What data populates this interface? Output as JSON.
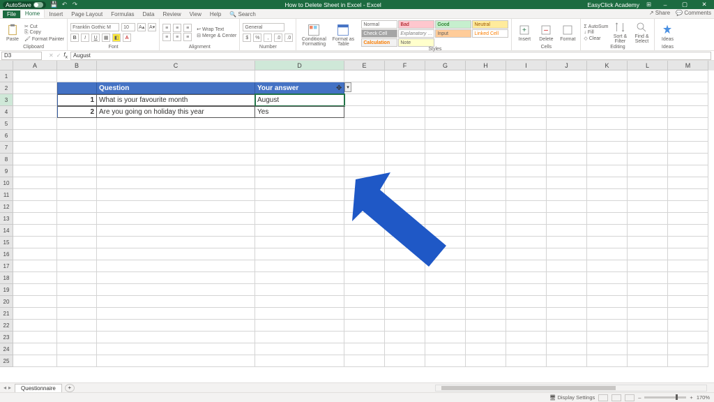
{
  "titlebar": {
    "autosave": "AutoSave",
    "doc_title": "How to Delete Sheet in Excel  -  Excel",
    "account": "EasyClick Academy",
    "min": "–",
    "max": "▢",
    "close": "✕"
  },
  "tabs": {
    "file": "File",
    "home": "Home",
    "insert": "Insert",
    "pagelayout": "Page Layout",
    "formulas": "Formulas",
    "data": "Data",
    "review": "Review",
    "view": "View",
    "help": "Help",
    "search": "Search",
    "share": "Share",
    "comments": "Comments"
  },
  "ribbon": {
    "clipboard": {
      "label": "Clipboard",
      "paste": "Paste",
      "cut": "Cut",
      "copy": "Copy",
      "painter": "Format Painter"
    },
    "font": {
      "label": "Font",
      "name": "Franklin Gothic M",
      "size": "10"
    },
    "alignment": {
      "label": "Alignment",
      "wrap": "Wrap Text",
      "merge": "Merge & Center"
    },
    "number": {
      "label": "Number",
      "fmt": "General"
    },
    "cf": {
      "label": "",
      "cf": "Conditional Formatting",
      "fat": "Format as Table"
    },
    "styles": {
      "label": "Styles",
      "normal": "Normal",
      "bad": "Bad",
      "good": "Good",
      "neutral": "Neutral",
      "calc": "Calculation",
      "check": "Check Cell",
      "expl": "Explanatory …",
      "input": "Input",
      "linked": "Linked Cell",
      "note": "Note"
    },
    "cells": {
      "label": "Cells",
      "insert": "Insert",
      "delete": "Delete",
      "format": "Format"
    },
    "editing": {
      "label": "Editing",
      "autosum": "AutoSum",
      "fill": "Fill",
      "clear": "Clear",
      "sort": "Sort & Filter",
      "find": "Find & Select"
    },
    "ideas": {
      "label": "Ideas",
      "ideas": "Ideas"
    }
  },
  "namebox": {
    "ref": "D3",
    "formula": "August"
  },
  "columns": [
    "A",
    "B",
    "C",
    "D",
    "E",
    "F",
    "G",
    "H",
    "I",
    "J",
    "K",
    "L",
    "M"
  ],
  "table": {
    "h1": "",
    "h2": "Question",
    "h3": "Your answer",
    "r1_idx": "1",
    "r1_q": "What is your favourite month",
    "r1_a": "August",
    "r2_idx": "2",
    "r2_q": "Are you going on holiday this year",
    "r2_a": "Yes"
  },
  "sheets": {
    "s1": "Questionnaire",
    "add": "+"
  },
  "status": {
    "display": "Display Settings",
    "zoom": "170%",
    "minus": "–",
    "plus": "+"
  }
}
